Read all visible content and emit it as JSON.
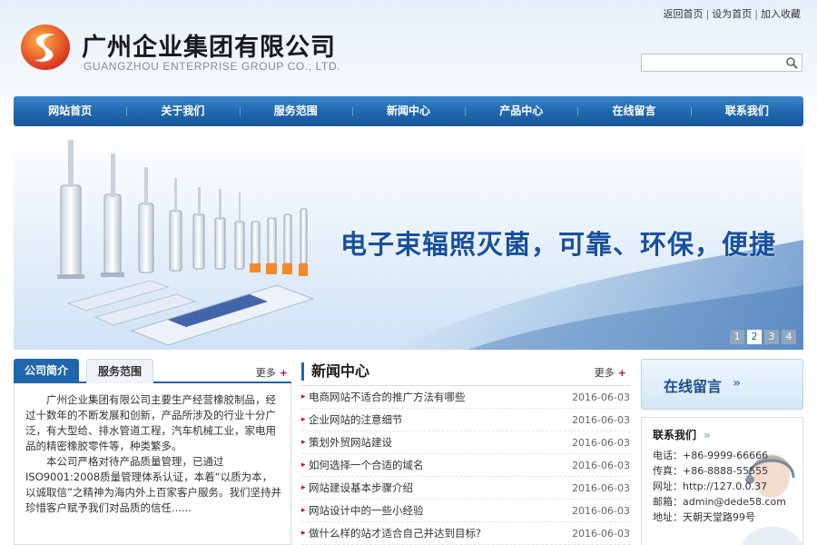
{
  "header": {
    "logo_cn": "广州企业集团有限公司",
    "logo_en": "GUANGZHOU ENTERPRISE GROUP CO., LTD.",
    "top_links": [
      "返回首页",
      "设为首页",
      "加入收藏"
    ],
    "search": {
      "value": "",
      "placeholder": ""
    }
  },
  "nav": [
    "网站首页",
    "关于我们",
    "服务范围",
    "新闻中心",
    "产品中心",
    "在线留言",
    "联系我们"
  ],
  "banner": {
    "slogan": "电子束辐照灭菌，可靠、环保，便捷",
    "pages": [
      "1",
      "2",
      "3",
      "4"
    ],
    "active_page": "2"
  },
  "about": {
    "tab_active": "公司简介",
    "tab_inactive": "服务范围",
    "more": "更多",
    "para1": "广州企业集团有限公司主要生产经营橡胶制品，经过十数年的不断发展和创新，产品所涉及的行业十分广泛，有大型给、排水管道工程，汽车机械工业，家电用品的精密橡胶零件等，种类繁多。",
    "para2": "本公司严格对待产品质量管理，已通过ISO9001:2008质量管理体系认证，本着“以质为本，以诚取信”之精神为海内外上百家客户服务。我们坚持并珍惜客户赋予我们对品质的信任......"
  },
  "news": {
    "title": "新闻中心",
    "more": "更多",
    "items": [
      {
        "title": "电商网站不适合的推广方法有哪些",
        "date": "2016-06-03"
      },
      {
        "title": "企业网站的注意细节",
        "date": "2016-06-03"
      },
      {
        "title": "策划外贸网站建设",
        "date": "2016-06-03"
      },
      {
        "title": "如何选择一个合适的域名",
        "date": "2016-06-03"
      },
      {
        "title": "网站建设基本步骤介绍",
        "date": "2016-06-03"
      },
      {
        "title": "网站设计中的一些小经验",
        "date": "2016-06-03"
      },
      {
        "title": "做什么样的站才适合自己并达到目标?",
        "date": "2016-06-03"
      }
    ]
  },
  "side": {
    "message_label": "在线留言",
    "contact_title": "联系我们",
    "contact": [
      {
        "k": "电话：",
        "v": "+86-9999-66666"
      },
      {
        "k": "传真：",
        "v": "+86-8888-55555"
      },
      {
        "k": "网址：",
        "v": "http://127.0.0.37"
      },
      {
        "k": "邮箱：",
        "v": "admin@dede58.com"
      },
      {
        "k": "地址：",
        "v": "天朝天堂路99号"
      }
    ]
  },
  "colors": {
    "nav_blue": "#1f66ad",
    "slogan_blue": "#17509f",
    "bullet_red": "#c0102a",
    "logo_red": "#d8281c",
    "logo_orange": "#f28c1c"
  },
  "icons": [
    "logo-swirl-icon",
    "search-icon",
    "headset-agent-icon",
    "double-chevron-right-icon"
  ]
}
